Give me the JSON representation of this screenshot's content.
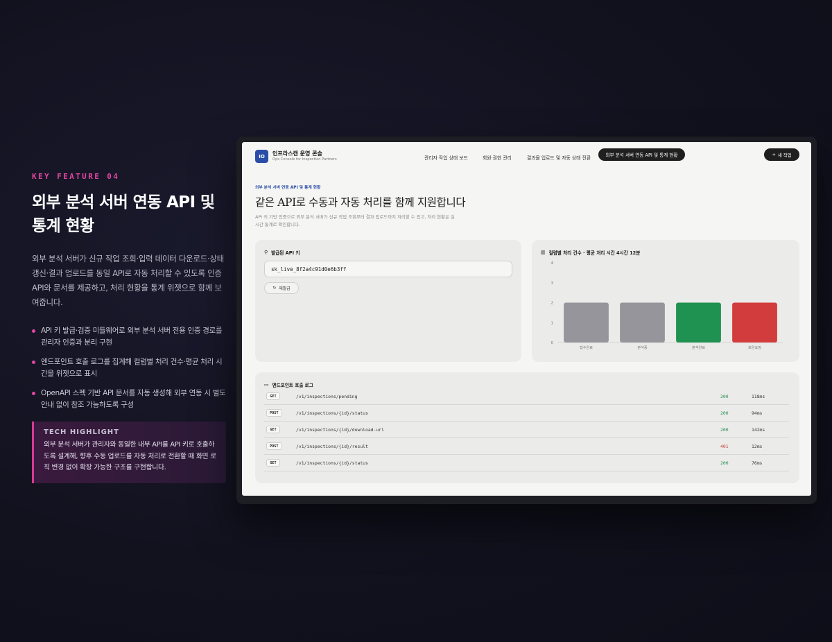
{
  "feature": {
    "eyebrow": "KEY FEATURE 04",
    "title_line1": "외부 분석 서버 연동 API 및",
    "title_line2": "통계 현황",
    "description": "외부 분석 서버가 신규 작업 조회·입력 데이터 다운로드·상태 갱신·결과 업로드를 동일 API로 자동 처리할 수 있도록 인증 API와 문서를 제공하고, 처리 현황을 통계 위젯으로 함께 보여줍니다.",
    "bullets": [
      "API 키 발급·검증 미들웨어로 외부 분석 서버 전용 인증 경로를 관리자 인증과 분리 구현",
      "엔드포인트 호출 로그를 집계해 컬럼별 처리 건수·평균 처리 시간을 위젯으로 표시",
      "OpenAPI 스펙 기반 API 문서를 자동 생성해 외부 연동 시 별도 안내 없이 참조 가능하도록 구성"
    ],
    "tech_title": "TECH HIGHLIGHT",
    "tech_desc": "외부 분석 서버가 관리자와 동일한 내부 API를 API 키로 호출하도록 설계해, 향후 수동 업로드를 자동 처리로 전환할 때 화면 로직 변경 없이 확장 가능한 구조를 구현합니다."
  },
  "app": {
    "logo_text": "IO",
    "brand_title": "인프라스캔 운영 콘솔",
    "brand_subtitle": "Ops Console for Inspection Partners",
    "tabs": [
      "관리자 작업 상태 보드",
      "회원·권한 관리",
      "결과물 업로드 및 자동 상태 전환",
      "외부 분석 서버 연동 API 및 통계 현황"
    ],
    "new_button": "새 작업",
    "new_icon": "plus-icon"
  },
  "page": {
    "eyebrow": "외부 분석 서버 연동 API 및 통계 현황",
    "title": "같은 API로 수동과 자동 처리를 함께 지원합니다",
    "subtitle_line1": "API 키 기반 인증으로 외부 분석 서버가 신규 작업 조회부터 결과 업로드까지 처리할 수 있고, 처리 현황은 실",
    "subtitle_line2": "시간 통계로 확인합니다."
  },
  "api_key": {
    "title": "발급된 API 키",
    "value": "sk_live_8f2a4c91d0e6b3ff",
    "regenerate": "재발급"
  },
  "chart_data": {
    "type": "bar",
    "title": "컬럼별 처리 건수 · 평균 처리 시간 4시간 12분",
    "categories": [
      "접수완료",
      "분석중",
      "분석완료",
      "보완요청"
    ],
    "values": [
      2,
      2,
      2,
      2
    ],
    "colors": [
      "#95959b",
      "#95959b",
      "#1f9150",
      "#d23c3c"
    ],
    "ylim": [
      0,
      4
    ],
    "yticks": [
      "0",
      "1",
      "2",
      "3",
      "4"
    ]
  },
  "log": {
    "title": "엔드포인트 호출 로그",
    "rows": [
      {
        "method": "GET",
        "path": "/v1/inspections/pending",
        "status": "200",
        "time": "118ms"
      },
      {
        "method": "POST",
        "path": "/v1/inspections/{id}/status",
        "status": "200",
        "time": "94ms"
      },
      {
        "method": "GET",
        "path": "/v1/inspections/{id}/download-url",
        "status": "200",
        "time": "142ms"
      },
      {
        "method": "POST",
        "path": "/v1/inspections/{id}/result",
        "status": "401",
        "time": "12ms"
      },
      {
        "method": "GET",
        "path": "/v1/inspections/{id}/status",
        "status": "200",
        "time": "76ms"
      }
    ],
    "status_colors": {
      "ok": "#1f8a4c",
      "error": "#c0392b"
    }
  }
}
